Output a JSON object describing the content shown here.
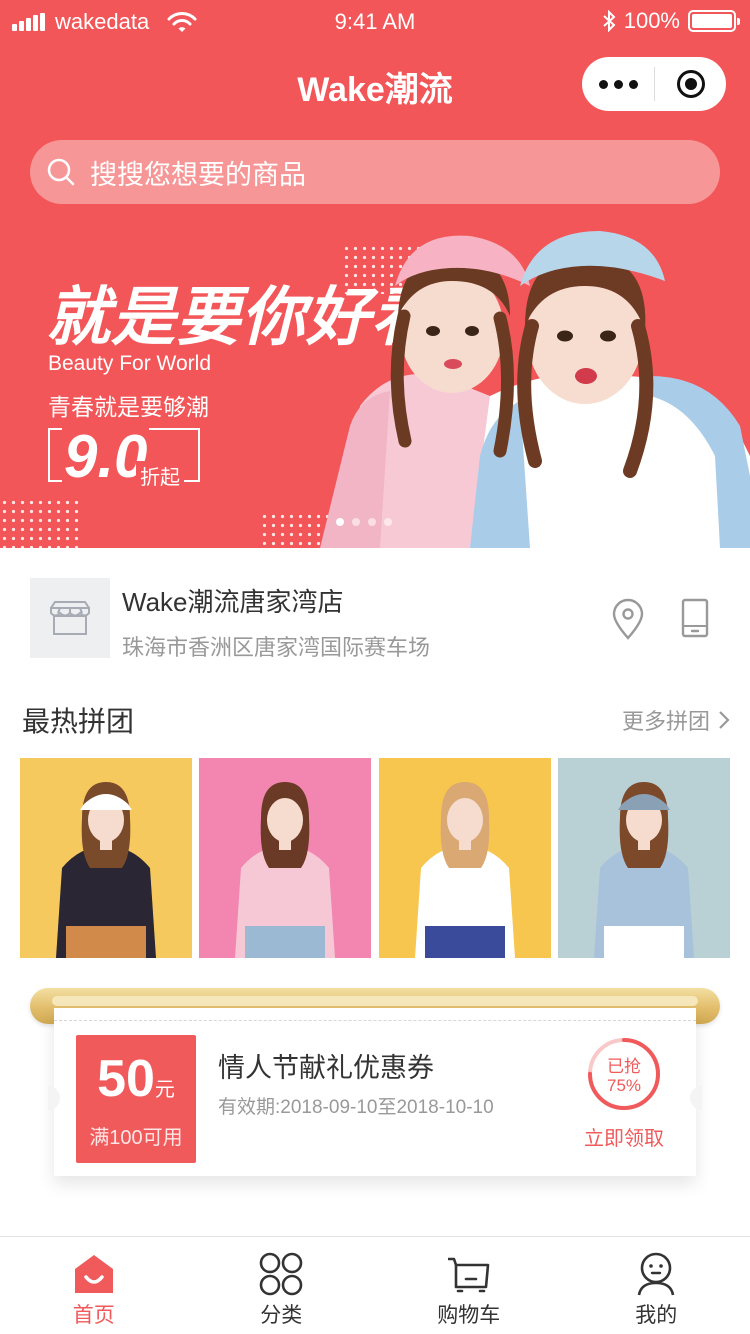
{
  "status_bar": {
    "carrier": "wakedata",
    "time": "9:41 AM",
    "battery": "100%"
  },
  "nav": {
    "title": "Wake潮流"
  },
  "search": {
    "placeholder": "搜搜您想要的商品"
  },
  "banner": {
    "headline": "就是要你好看",
    "subtitle_en": "Beauty For World",
    "subtitle_cn": "青春就是要够潮",
    "discount_value": "9.0",
    "discount_suffix": "折起",
    "slide_count": 4,
    "active_slide": 1
  },
  "store": {
    "name": "Wake潮流唐家湾店",
    "address": "珠海市香洲区唐家湾国际赛车场"
  },
  "hot_group": {
    "title": "最热拼团",
    "more_label": "更多拼团",
    "items": [
      {
        "bg": "#f5c95d",
        "top": "#2a2634",
        "bottom": "#d18a4a",
        "hair": "#7a4b2a",
        "hat": "#ffffff"
      },
      {
        "bg": "#f286b1",
        "top": "#f6c8d6",
        "bottom": "#9cb9d3",
        "hair": "#6b3a26",
        "hat": ""
      },
      {
        "bg": "#f7c64f",
        "top": "#ffffff",
        "bottom": "#3b4b9c",
        "hair": "#d9a873",
        "hat": ""
      },
      {
        "bg": "#b9d0d4",
        "top": "#a8c2dc",
        "bottom": "#ffffff",
        "hair": "#7c4a2b",
        "hat": "#8aa0b4"
      }
    ]
  },
  "coupon": {
    "amount": "50",
    "unit": "元",
    "condition": "满100可用",
    "title": "情人节献礼优惠券",
    "validity": "有效期:2018-09-10至2018-10-10",
    "claimed_label": "已抢",
    "claimed_percent": "75%",
    "claimed_fraction": 0.75,
    "claim_button": "立即领取"
  },
  "tabbar": {
    "items": [
      {
        "label": "首页",
        "icon": "home-icon",
        "active": true
      },
      {
        "label": "分类",
        "icon": "category-icon",
        "active": false
      },
      {
        "label": "购物车",
        "icon": "cart-icon",
        "active": false
      },
      {
        "label": "我的",
        "icon": "profile-icon",
        "active": false
      }
    ]
  },
  "colors": {
    "brand": "#f25658",
    "accent": "#f05a5b",
    "muted_text": "#999999"
  }
}
